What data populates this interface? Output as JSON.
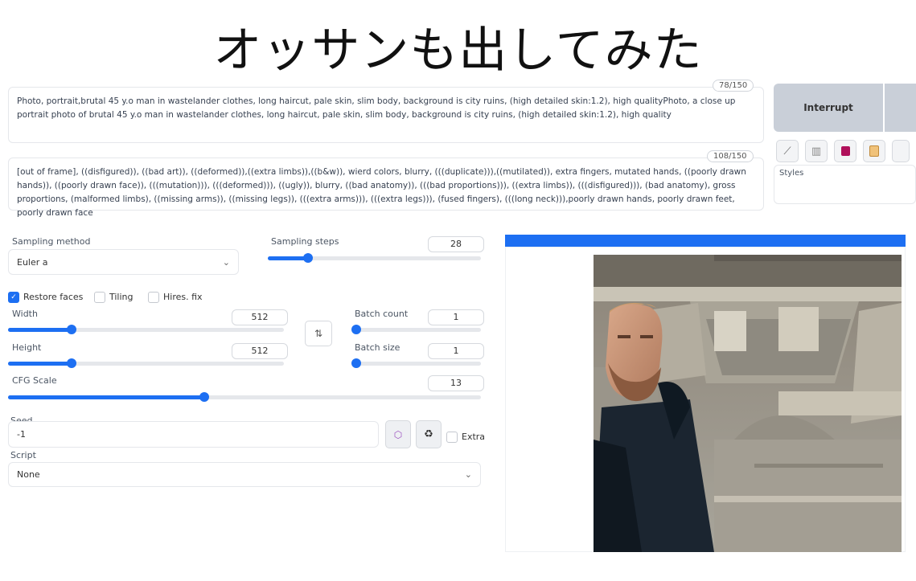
{
  "title": "オッサンも出してみた",
  "prompt": {
    "counter": "78/150",
    "text": "Photo, portrait,brutal 45 y.o man in wastelander clothes, long haircut, pale skin, slim body, background is city ruins, (high detailed skin:1.2), high qualityPhoto, a close up portrait photo of brutal 45 y.o man in wastelander clothes, long haircut, pale skin, slim body, background is city ruins, (high detailed skin:1.2), high quality"
  },
  "negative_prompt": {
    "counter": "108/150",
    "text": "[out of frame], ((disfigured)), ((bad art)), ((deformed)),((extra limbs)),((b&w)), wierd colors, blurry, (((duplicate))),((mutilated)), extra fingers, mutated hands, ((poorly drawn hands)), ((poorly drawn face)), (((mutation))), (((deformed))), ((ugly)), blurry, ((bad anatomy)), (((bad proportions))), ((extra limbs)), (((disfigured))), (bad anatomy), gross proportions, (malformed limbs), ((missing arms)), ((missing legs)), (((extra arms))), (((extra legs))), (fused fingers), (((long neck))),poorly drawn hands, poorly drawn feet, poorly drawn face"
  },
  "actions": {
    "interrupt_label": "Interrupt",
    "styles_label": "Styles",
    "tools": [
      {
        "icon": "pencil-icon",
        "glyph": "⟋"
      },
      {
        "icon": "trash-icon",
        "glyph": "🗑"
      },
      {
        "icon": "save-style-icon",
        "glyph": "■"
      },
      {
        "icon": "clipboard-icon",
        "glyph": "📋"
      }
    ]
  },
  "sampling": {
    "method_label": "Sampling method",
    "method_value": "Euler a",
    "steps_label": "Sampling steps",
    "steps_value": "28",
    "steps_fraction": 0.19
  },
  "checkboxes": [
    {
      "label": "Restore faces",
      "checked": true
    },
    {
      "label": "Tiling",
      "checked": false
    },
    {
      "label": "Hires. fix",
      "checked": false
    }
  ],
  "width": {
    "label": "Width",
    "value": "512",
    "fraction": 0.23
  },
  "height": {
    "label": "Height",
    "value": "512",
    "fraction": 0.23
  },
  "swap_glyph": "⇅",
  "batch_count": {
    "label": "Batch count",
    "value": "1",
    "fraction": 0.0
  },
  "batch_size": {
    "label": "Batch size",
    "value": "1",
    "fraction": 0.0
  },
  "cfg": {
    "label": "CFG Scale",
    "value": "13",
    "fraction": 0.415
  },
  "seed": {
    "label": "Seed",
    "value": "-1",
    "extra_label": "Extra"
  },
  "script": {
    "label": "Script",
    "value": "None"
  },
  "progress": {
    "fraction": 1.0
  },
  "colors": {
    "accent": "#1d6ff2",
    "interrupt_bg": "#c9cfd8"
  }
}
